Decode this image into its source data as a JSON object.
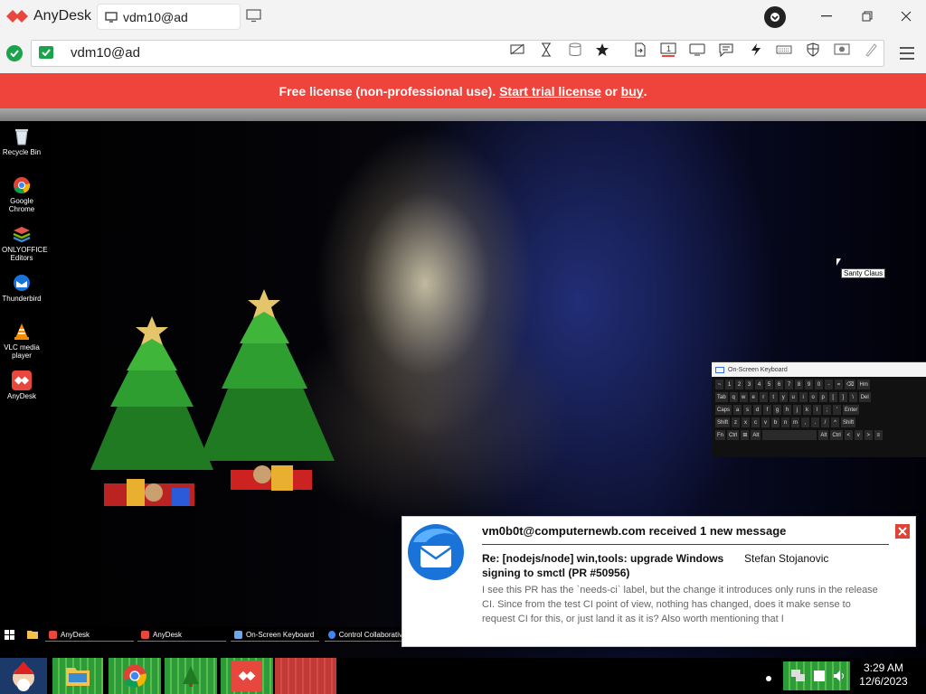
{
  "titlebar": {
    "app_name": "AnyDesk",
    "tab_label": "vdm10@ad",
    "brand_color": "#e8473e"
  },
  "addressbar": {
    "address": "vdm10@ad",
    "toolbar_icons": [
      "privacy-icon",
      "hourglass-icon",
      "database-icon",
      "favorite-star-icon",
      "file-transfer-icon",
      "display-1-icon",
      "monitor-icon",
      "chat-icon",
      "actions-lightning-icon",
      "keyboard-icon",
      "permissions-icon",
      "record-icon",
      "whiteboard-pen-icon"
    ]
  },
  "banner": {
    "prefix": "Free license (non-professional use). ",
    "trial_link": "Start trial license",
    "middle": " or ",
    "buy_link": "buy",
    "suffix": ".",
    "color": "#ef443b"
  },
  "desktop": {
    "icons": [
      {
        "label": "Recycle Bin"
      },
      {
        "label": "Google Chrome"
      },
      {
        "label": "ONLYOFFICE Editors"
      },
      {
        "label": "Thunderbird"
      },
      {
        "label": "VLC media player"
      },
      {
        "label": "AnyDesk"
      }
    ],
    "tooltip": "Santy Claus",
    "osk": {
      "title": "On-Screen Keyboard",
      "rows": [
        [
          "~",
          "1",
          "2",
          "3",
          "4",
          "5",
          "6",
          "7",
          "8",
          "9",
          "0",
          "-",
          "=",
          "⌫",
          "Hm"
        ],
        [
          "Tab",
          "q",
          "w",
          "e",
          "r",
          "t",
          "y",
          "u",
          "i",
          "o",
          "p",
          "[",
          "]",
          "\\",
          "Del"
        ],
        [
          "Caps",
          "a",
          "s",
          "d",
          "f",
          "g",
          "h",
          "j",
          "k",
          "l",
          ";",
          "'",
          "Enter"
        ],
        [
          "Shift",
          "z",
          "x",
          "c",
          "v",
          "b",
          "n",
          "m",
          ",",
          ".",
          "/",
          "^",
          "Shift"
        ],
        [
          "Fn",
          "Ctrl",
          "⊞",
          "Alt",
          " ",
          "Alt",
          "Ctrl",
          "<",
          "v",
          ">",
          "≡"
        ]
      ]
    },
    "inner_taskbar": [
      {
        "label": "AnyDesk"
      },
      {
        "label": "AnyDesk"
      },
      {
        "label": "On-Screen Keyboard"
      },
      {
        "label": "Control Collaborativ"
      }
    ]
  },
  "notification": {
    "header": "vm0b0t@computernewb.com received 1 new message",
    "subject": "Re: [nodejs/node] win,tools: upgrade Windows signing to smctl (PR #50956)",
    "author": "Stefan Stojanovic",
    "body": "I see this PR has the `needs-ci` label, but the change it introduces only runs in the release CI. Since from the test CI point of view, nothing has changed, does it make sense to request CI for this, or just land it as it is? Also worth mentioning that I"
  },
  "taskbar": {
    "time": "3:29 AM",
    "date": "12/6/2023"
  }
}
